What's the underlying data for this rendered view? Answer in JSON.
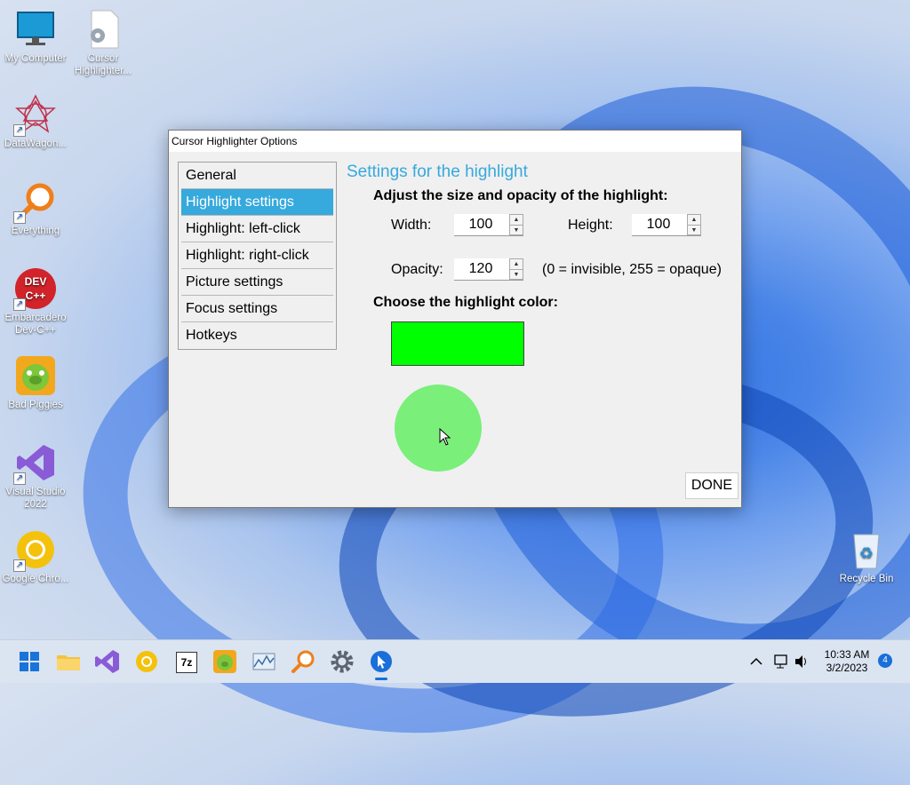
{
  "desktop": {
    "icons": [
      {
        "label": "My Computer"
      },
      {
        "label": "Cursor Highlighter..."
      },
      {
        "label": "DataWagon..."
      },
      {
        "label": "Everything"
      },
      {
        "label": "Embarcadero Dev-C++"
      },
      {
        "label": "Bad Piggies"
      },
      {
        "label": "Visual Studio 2022"
      },
      {
        "label": "Google Chro..."
      },
      {
        "label": "Recycle Bin"
      }
    ],
    "devcpp_logo_text": "DEV C++"
  },
  "dialog": {
    "title": "Cursor Highlighter Options",
    "nav": [
      {
        "label": "General"
      },
      {
        "label": "Highlight settings"
      },
      {
        "label": "Highlight: left-click"
      },
      {
        "label": "Highlight: right-click"
      },
      {
        "label": "Picture settings"
      },
      {
        "label": "Focus settings"
      },
      {
        "label": "Hotkeys"
      }
    ],
    "active_nav_index": 1,
    "heading": "Settings for the highlight",
    "size_section_label": "Adjust the size and opacity of the highlight:",
    "width_label": "Width:",
    "width_value": "100",
    "height_label": "Height:",
    "height_value": "100",
    "opacity_label": "Opacity:",
    "opacity_value": "120",
    "opacity_hint": "(0 = invisible, 255 = opaque)",
    "color_section_label": "Choose the highlight color:",
    "highlight_color": "#00ff00",
    "preview_color": "#7aef7a",
    "done_label": "DONE"
  },
  "taskbar": {
    "apps": [
      "start-icon",
      "file-explorer-icon",
      "visual-studio-icon",
      "chrome-icon",
      "7zip-icon",
      "bad-piggies-icon",
      "datawagon-icon",
      "everything-icon",
      "settings-icon",
      "cursor-highlighter-icon"
    ],
    "active_app": "cursor-highlighter-icon",
    "seven_zip_label": "7z",
    "time": "10:33 AM",
    "date": "3/2/2023",
    "notification_count": "4"
  },
  "colors": {
    "accent": "#36a9dd",
    "taskbar_bg": "#dbe4f1"
  }
}
